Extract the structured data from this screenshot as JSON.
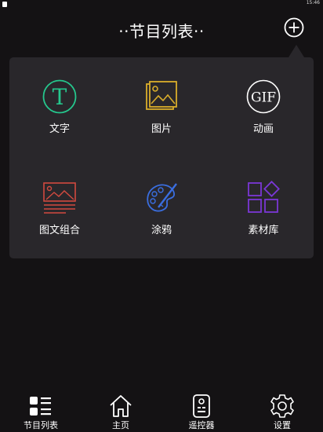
{
  "status_bar": {
    "time": "15:46"
  },
  "header": {
    "title": "··节目列表··"
  },
  "menu": {
    "items": [
      {
        "label": "文字",
        "icon": "text-icon",
        "color": "#25c78d",
        "glyph": "T"
      },
      {
        "label": "图片",
        "icon": "image-icon",
        "color": "#d9ad2b"
      },
      {
        "label": "动画",
        "icon": "gif-icon",
        "color": "#ffffff",
        "glyph": "GIF"
      },
      {
        "label": "图文组合",
        "icon": "image-text-icon",
        "color": "#d24a3f"
      },
      {
        "label": "涂鸦",
        "icon": "paint-palette-icon",
        "color": "#3a6ee0"
      },
      {
        "label": "素材库",
        "icon": "material-library-icon",
        "color": "#7a37d6"
      }
    ]
  },
  "tabbar": {
    "items": [
      {
        "label": "节目列表",
        "icon": "program-list-icon",
        "active": true
      },
      {
        "label": "主页",
        "icon": "home-icon",
        "active": false
      },
      {
        "label": "遥控器",
        "icon": "remote-control-icon",
        "active": false
      },
      {
        "label": "设置",
        "icon": "gear-icon",
        "active": false
      }
    ]
  }
}
